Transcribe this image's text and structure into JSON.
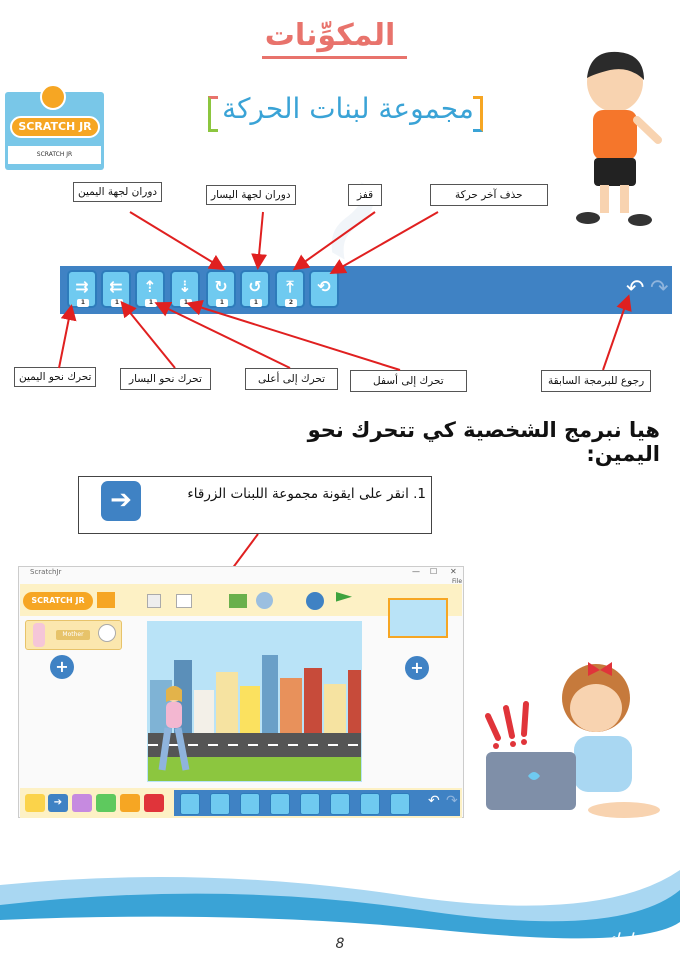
{
  "title": "المكوِّنات",
  "subtitle": "مجموعة لبنات الحركة",
  "logo": {
    "badge": "SCRATCH JR",
    "caption": "SCRATCH JR"
  },
  "labels_top": {
    "turn_right": "دوران لجهة اليمين",
    "turn_left": "دوران لجهة اليسار",
    "hop": "قفز",
    "reset": "حذف آخر حركة"
  },
  "labels_bottom": {
    "move_right": "تحرك نحو اليمين",
    "move_left": "تحرك نحو اليسار",
    "move_up": "تحرك إلى أعلى",
    "move_down": "تحرك إلى أسفل",
    "undo": "رجوع للبرمجة السابقة"
  },
  "toolbar": {
    "blocks": [
      {
        "icon": "⇉",
        "num": "1"
      },
      {
        "icon": "⇇",
        "num": "1"
      },
      {
        "icon": "⇡",
        "num": "1"
      },
      {
        "icon": "⇣",
        "num": "1"
      },
      {
        "icon": "↻",
        "num": "1"
      },
      {
        "icon": "↺",
        "num": "1"
      },
      {
        "icon": "⤒",
        "num": "2"
      },
      {
        "icon": "⟲",
        "num": ""
      }
    ],
    "undo_icon": "↶",
    "redo_icon": "↷"
  },
  "lets_program": "هيا نبرمج الشخصية كي تتحرك نحو اليمين:",
  "step1": {
    "text": "1. انقر على ايقونة مجموعة اللبنات الزرقاء",
    "icon": "➔"
  },
  "screenshot": {
    "window_title": "ScratchJr",
    "file_menu": "File",
    "logo_text": "SCRATCH JR",
    "character_name": "Mother",
    "plus": "+",
    "win_min": "—",
    "win_max": "☐",
    "win_close": "✕"
  },
  "footer": {
    "page_number": "8",
    "author": "بارك مجوبي"
  },
  "colors": {
    "accent_red": "#e8736c",
    "accent_blue": "#3aa3d6",
    "toolbar_blue": "#3f82c4",
    "block_blue": "#6fcaf0",
    "arrow_red": "#e02020"
  }
}
